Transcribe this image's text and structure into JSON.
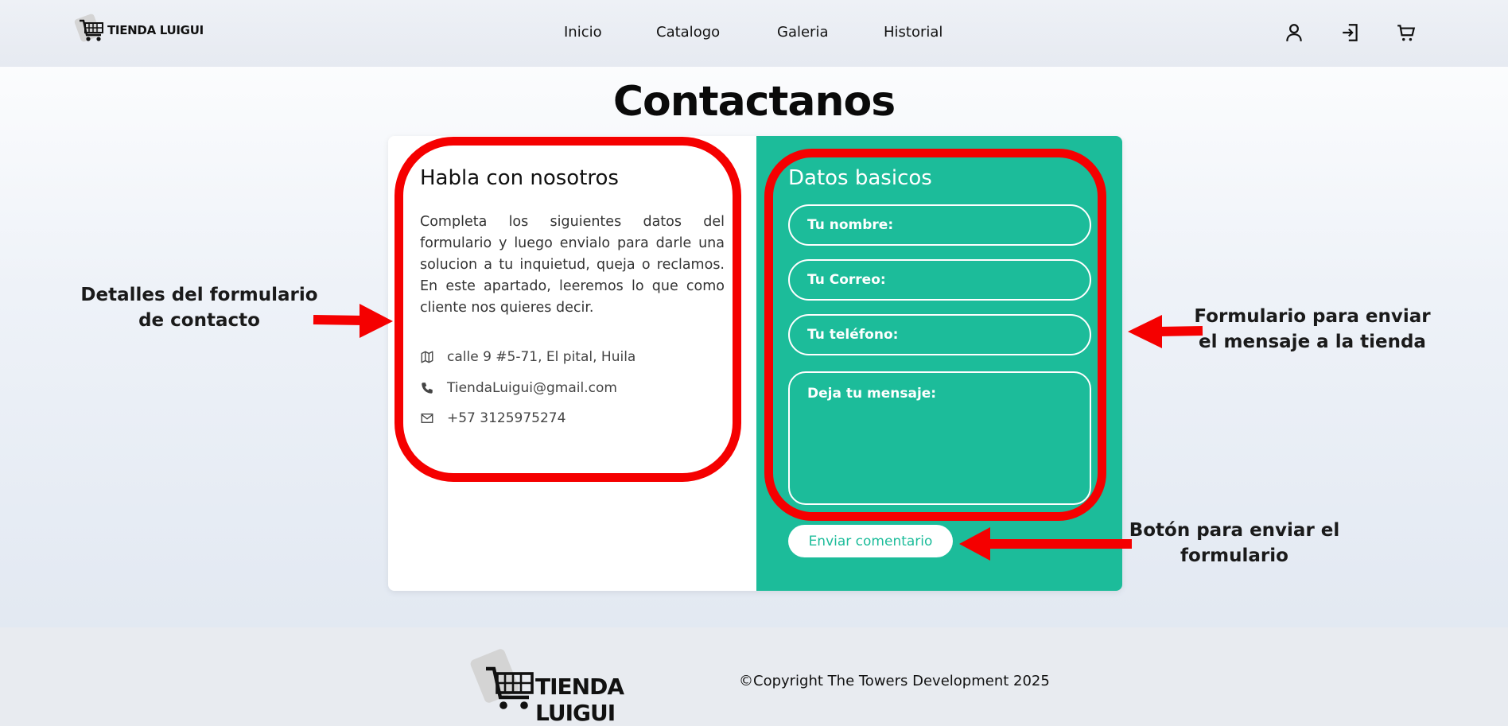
{
  "header": {
    "logo_text": "TIENDA LUIGUI",
    "nav": [
      {
        "label": "Inicio"
      },
      {
        "label": "Catalogo"
      },
      {
        "label": "Galeria"
      },
      {
        "label": "Historial"
      }
    ],
    "icons": [
      "user-icon",
      "logout-icon",
      "cart-icon"
    ]
  },
  "page": {
    "title": "Contactanos"
  },
  "contact_info": {
    "title": "Habla con nosotros",
    "description": "Completa los siguientes datos del formulario y luego envialo para darle una solucion a tu inquietud, queja o reclamos. En este apartado, leeremos lo que como cliente nos quieres decir.",
    "address": "calle 9 #5-71, El pital, Huila",
    "email": "TiendaLuigui@gmail.com",
    "phone": "+57 3125975274"
  },
  "form": {
    "title": "Datos basicos",
    "name_placeholder": "Tu nombre:",
    "email_placeholder": "Tu Correo:",
    "phone_placeholder": "Tu teléfono:",
    "message_placeholder": "Deja tu mensaje:",
    "submit_label": "Enviar comentario"
  },
  "annotations": {
    "left_line1": "Detalles del formulario",
    "left_line2": "de contacto",
    "right_line1": "Formulario para enviar",
    "right_line2": "el mensaje a la tienda",
    "button_line1": "Botón para enviar el",
    "button_line2": "formulario"
  },
  "footer": {
    "logo_text": "TIENDA LUIGUI",
    "copyright": "©Copyright The Towers Development 2025"
  },
  "colors": {
    "accent": "#1cbc9a",
    "highlight": "#f50000"
  }
}
